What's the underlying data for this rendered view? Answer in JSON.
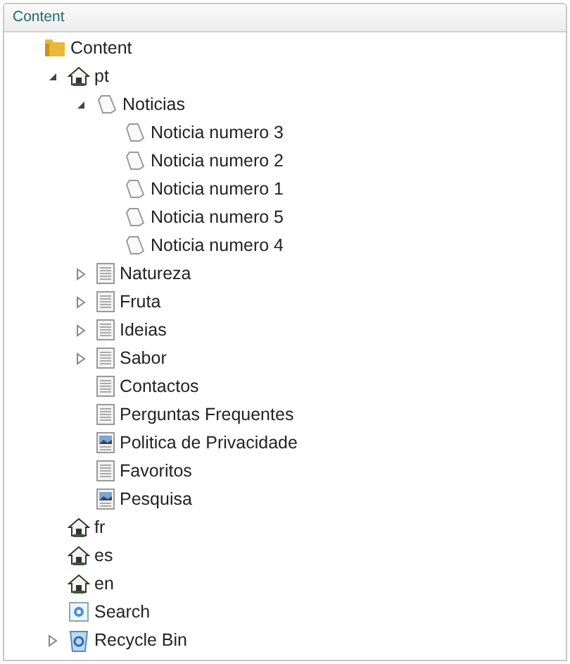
{
  "panel": {
    "title": "Content"
  },
  "tree": [
    {
      "label": "Content",
      "kind": "folder",
      "children": [
        {
          "label": "pt",
          "kind": "house",
          "expanded": true,
          "children": [
            {
              "label": "Noticias",
              "kind": "scroll",
              "expanded": true,
              "children": [
                {
                  "label": "Noticia numero 3",
                  "kind": "scroll"
                },
                {
                  "label": "Noticia numero 2",
                  "kind": "scroll"
                },
                {
                  "label": "Noticia numero 1",
                  "kind": "scroll"
                },
                {
                  "label": "Noticia numero 5",
                  "kind": "scroll"
                },
                {
                  "label": "Noticia numero 4",
                  "kind": "scroll"
                }
              ]
            },
            {
              "label": "Natureza",
              "kind": "document",
              "expanded": false
            },
            {
              "label": "Fruta",
              "kind": "document",
              "expanded": false
            },
            {
              "label": "Ideias",
              "kind": "document",
              "expanded": false
            },
            {
              "label": "Sabor",
              "kind": "document",
              "expanded": false
            },
            {
              "label": "Contactos",
              "kind": "document"
            },
            {
              "label": "Perguntas Frequentes",
              "kind": "document"
            },
            {
              "label": "Politica de Privacidade",
              "kind": "image"
            },
            {
              "label": "Favoritos",
              "kind": "document"
            },
            {
              "label": "Pesquisa",
              "kind": "image"
            }
          ]
        },
        {
          "label": "fr",
          "kind": "house"
        },
        {
          "label": "es",
          "kind": "house"
        },
        {
          "label": "en",
          "kind": "house"
        },
        {
          "label": "Search",
          "kind": "search"
        },
        {
          "label": "Recycle Bin",
          "kind": "recycle",
          "expanded": false
        }
      ]
    }
  ]
}
